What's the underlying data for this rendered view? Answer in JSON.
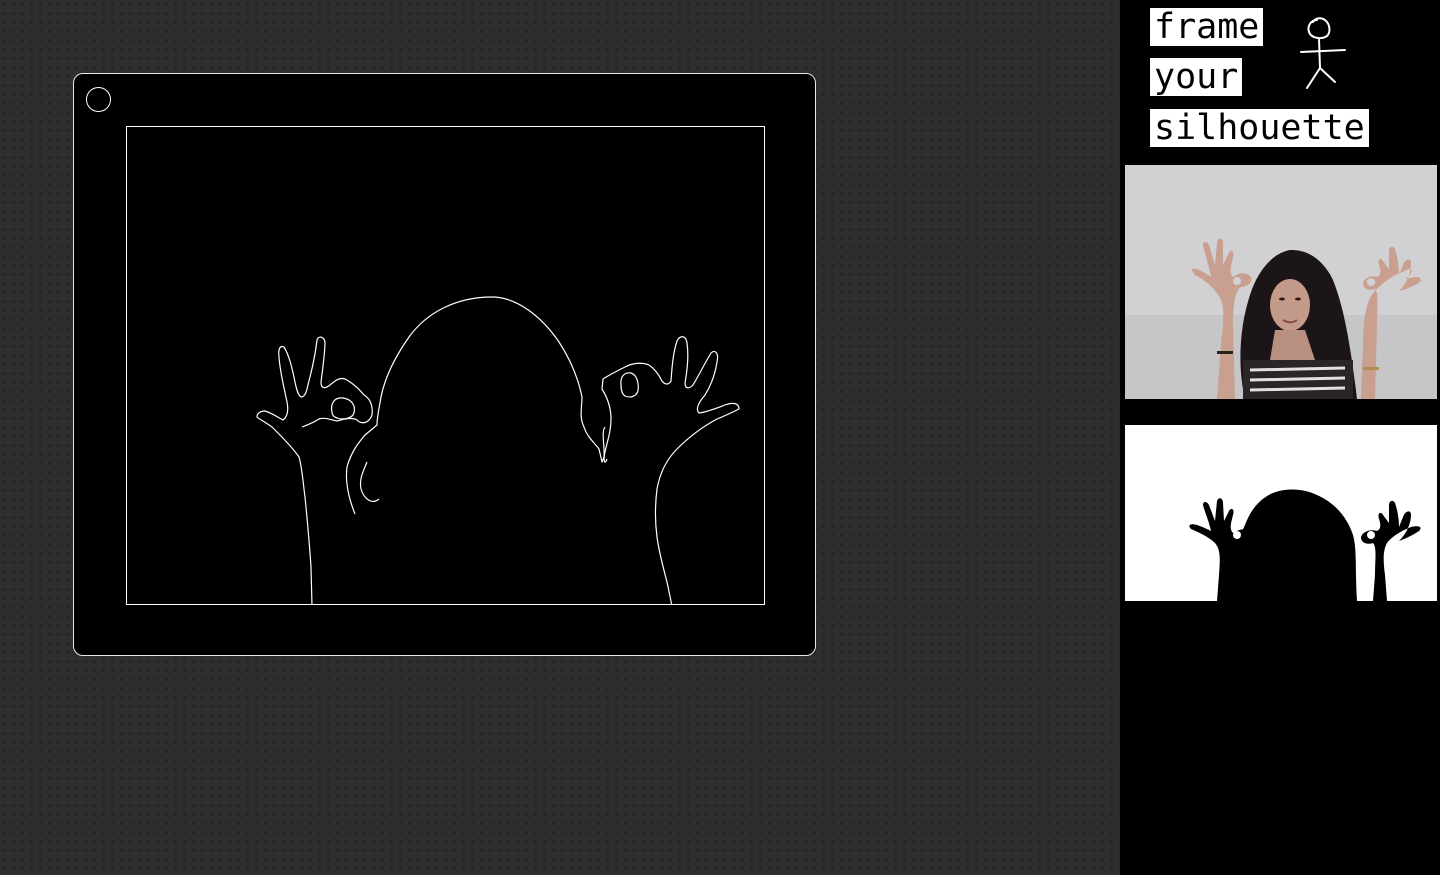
{
  "app": {
    "title_words": [
      "frame",
      "your",
      "silhouette"
    ]
  },
  "icons": {
    "logo": "stick-figure-icon",
    "device_button": "circle-button-icon"
  },
  "colors": {
    "page_background": "#2e2e2e",
    "frame": "#000000",
    "outline": "#ffffff",
    "title_background": "#ffffff",
    "title_text": "#000000"
  },
  "views": {
    "main": "silhouette-outline",
    "camera": "webcam-feed",
    "mask": "silhouette-mask"
  }
}
